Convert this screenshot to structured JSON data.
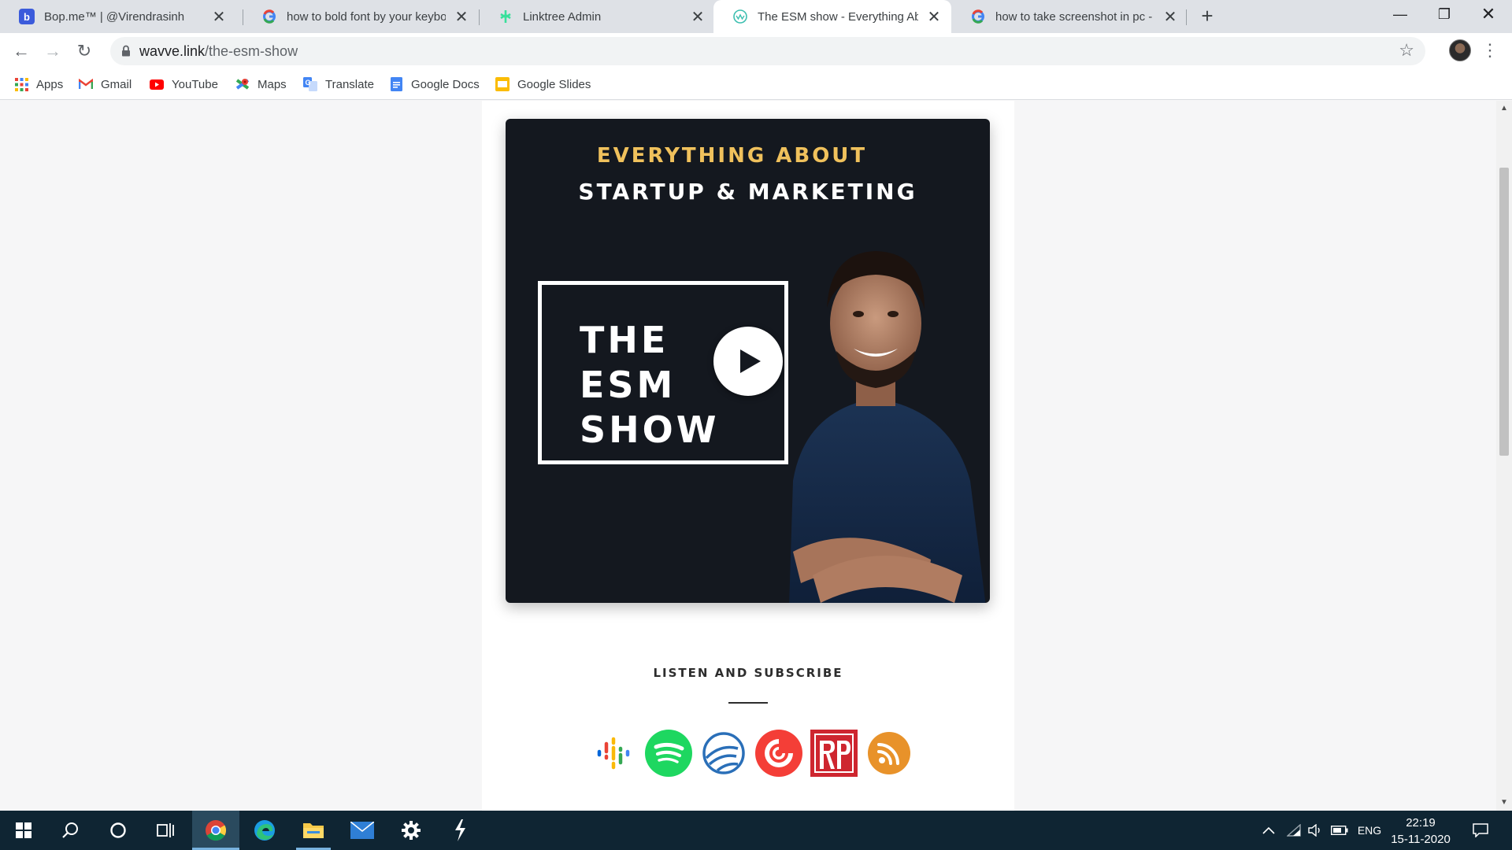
{
  "browser": {
    "tabs": [
      {
        "title": "Bop.me™ | @Virendrasinh",
        "favicon": "bopme-icon",
        "active": false
      },
      {
        "title": "how to bold font by your keyboard",
        "favicon": "google-icon",
        "active": false
      },
      {
        "title": "Linktree Admin",
        "favicon": "linktree-icon",
        "active": false
      },
      {
        "title": "The ESM show - Everything About",
        "favicon": "wavve-icon",
        "active": true
      },
      {
        "title": "how to take screenshot in pc - Go",
        "favicon": "google-icon",
        "active": false
      }
    ],
    "new_tab_label": "+",
    "address": {
      "domain": "wavve.link",
      "path": "/the-esm-show"
    },
    "bookmarks": [
      {
        "label": "Apps",
        "icon": "apps-grid-icon"
      },
      {
        "label": "Gmail",
        "icon": "gmail-icon"
      },
      {
        "label": "YouTube",
        "icon": "youtube-icon"
      },
      {
        "label": "Maps",
        "icon": "maps-icon"
      },
      {
        "label": "Translate",
        "icon": "translate-icon"
      },
      {
        "label": "Google Docs",
        "icon": "google-docs-icon"
      },
      {
        "label": "Google Slides",
        "icon": "google-slides-icon"
      }
    ]
  },
  "page": {
    "artwork": {
      "headline_top": "EVERYTHING ABOUT",
      "headline_bottom": "STARTUP & MARKETING",
      "show_title_lines": [
        "THE",
        "ESM",
        "SHOW"
      ]
    },
    "listen_heading": "LISTEN AND SUBSCRIBE",
    "platforms": [
      "google-podcasts-icon",
      "spotify-icon",
      "castbox-icon",
      "pocket-casts-icon",
      "radiopublic-icon",
      "rss-feed-icon"
    ]
  },
  "taskbar": {
    "language": "ENG",
    "time": "22:19",
    "date": "15-11-2020"
  },
  "colors": {
    "tab_strip": "#dee1e6",
    "artwork_bg": "#14181f",
    "headline_accent": "#f0c15c",
    "taskbar": "#0f2533"
  }
}
